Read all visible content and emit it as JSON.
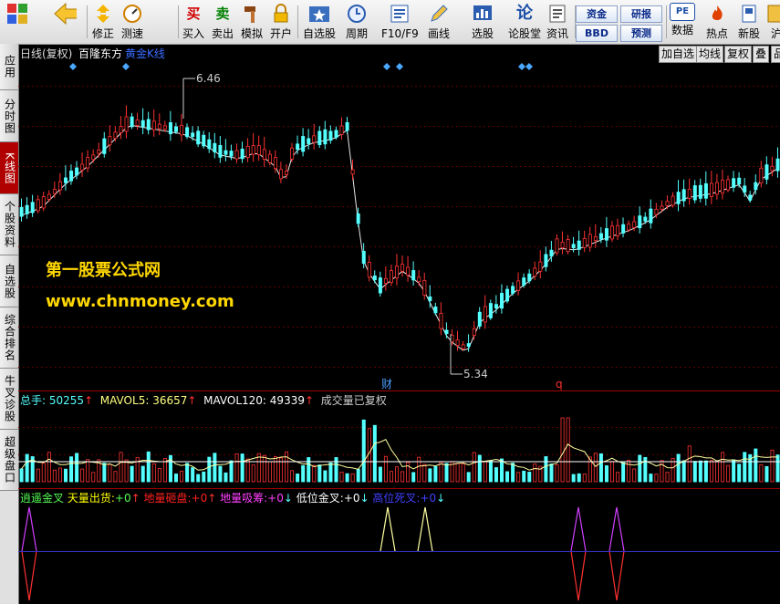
{
  "toolbar": {
    "items": [
      {
        "label": "",
        "icon": "grid-icon"
      },
      {
        "label": "",
        "icon": "back-arrow-icon"
      },
      {
        "label": "修正",
        "icon": "up-down-arrows-icon"
      },
      {
        "label": "测速",
        "icon": "speedometer-icon"
      },
      {
        "label": "买入",
        "glyph": "买"
      },
      {
        "label": "卖出",
        "glyph": "卖"
      },
      {
        "label": "模拟",
        "icon": "hammer-icon"
      },
      {
        "label": "开户",
        "icon": "lock-icon"
      },
      {
        "label": "自选股",
        "icon": "star-folder-icon"
      },
      {
        "label": "周期",
        "icon": "clock-cycle-icon"
      },
      {
        "label": "F10/F9",
        "icon": "document-chart-icon"
      },
      {
        "label": "画线",
        "icon": "pencil-icon"
      },
      {
        "label": "选股",
        "icon": "stock-screen-icon"
      },
      {
        "label": "论股堂",
        "glyph": "论"
      },
      {
        "label": "资讯",
        "icon": "news-icon"
      },
      {
        "label": "数据",
        "glyph": "PE"
      },
      {
        "label": "热点",
        "icon": "flame-icon"
      },
      {
        "label": "新股",
        "icon": "new-stock-icon"
      },
      {
        "label": "沪",
        "icon": "sh-icon"
      }
    ],
    "small_buttons": {
      "zijin": "资金",
      "bbd": "BBD",
      "yanbao": "研报",
      "yuce": "预测"
    }
  },
  "sidebar": {
    "tabs": [
      {
        "label": "应用"
      },
      {
        "label": "分时图"
      },
      {
        "label": "K线图",
        "active": true
      },
      {
        "label": "个股资料"
      },
      {
        "label": "自选股"
      },
      {
        "label": "综合排名"
      },
      {
        "label": "牛叉诊股"
      },
      {
        "label": "超级盘口"
      }
    ]
  },
  "header": {
    "period": "日线(复权)",
    "stock_name": "百隆东方",
    "indicator": "黄金K线",
    "buttons": {
      "add": "加自选",
      "ma": "均线",
      "restore": "复权",
      "overlay": "叠",
      "more": "品"
    }
  },
  "price_chart": {
    "high_label": "6.46",
    "low_label": "5.34",
    "event_marks": {
      "cai": "财",
      "q": "q"
    },
    "colors": {
      "up": "#ff3232",
      "down": "#54ffff",
      "ma": "#ffffff"
    }
  },
  "watermark": {
    "line1": "第一股票公式网",
    "line2": "www.chnmoney.com",
    "color": "#ffd700"
  },
  "volume": {
    "total_label": "总手:",
    "total_value": "50255",
    "mavol5_label": "MAVOL5:",
    "mavol5_value": "36657",
    "mavol120_label": "MAVOL120:",
    "mavol120_value": "49339",
    "note": "成交量已复权",
    "up_arrow": "↑"
  },
  "indicator_panel": {
    "name": "逍遥金叉",
    "items": [
      {
        "label": "天量出货:",
        "value": "+0",
        "arrow": "↑",
        "color": "#ffff00"
      },
      {
        "label": "地量砸盘:",
        "value": "+0",
        "arrow": "↑",
        "color": "#ff2020"
      },
      {
        "label": "地量吸筹:",
        "value": "+0",
        "arrow": "↓",
        "color": "#ff40ff"
      },
      {
        "label": "低位金叉:",
        "value": "+0",
        "arrow": "↓",
        "color": "#ffffff"
      },
      {
        "label": "高位死叉:",
        "value": "+0",
        "arrow": "↓",
        "color": "#4040ff"
      }
    ]
  }
}
